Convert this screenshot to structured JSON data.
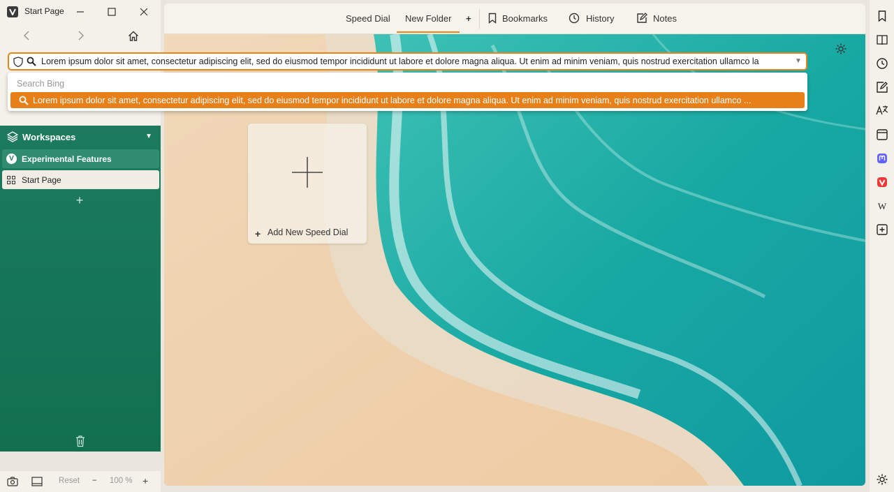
{
  "window": {
    "title": "Start Page",
    "minimize": "—",
    "maximize": "☐",
    "close": "✕"
  },
  "nav": {
    "back": "‹",
    "forward": "›",
    "home": "⌂"
  },
  "address_bar": {
    "value": "Lorem ipsum dolor sit amet, consectetur adipiscing elit, sed do eiusmod tempor incididunt ut labore et dolore magna aliqua. Ut enim ad minim veniam, quis nostrud exercitation ullamco la",
    "dropdown": "▼"
  },
  "suggestions": {
    "engine_label": "Search Bing",
    "hit": "Lorem ipsum dolor sit amet, consectetur adipiscing elit, sed do eiusmod tempor incididunt ut labore et dolore magna aliqua. Ut enim ad minim veniam, quis nostrud exercitation ullamco ..."
  },
  "panel": {
    "workspaces_label": "Workspaces",
    "items": [
      {
        "label": "Experimental Features",
        "icon": "vivaldi-icon"
      },
      {
        "label": "Start Page",
        "icon": "grid-icon"
      }
    ],
    "add_tab": "+"
  },
  "status_bar": {
    "reset": "Reset",
    "zoom_minus": "−",
    "zoom": "100 %",
    "zoom_plus": "+"
  },
  "start_page": {
    "tabs": [
      {
        "label": "Speed Dial",
        "active": false
      },
      {
        "label": "New Folder",
        "active": true
      }
    ],
    "add_folder": "+",
    "links": [
      {
        "label": "Bookmarks",
        "icon": "bookmark-icon"
      },
      {
        "label": "History",
        "icon": "clock-icon"
      },
      {
        "label": "Notes",
        "icon": "notes-icon"
      }
    ],
    "add_speed_dial_plus": "+",
    "add_speed_dial_label": "Add New Speed Dial"
  },
  "right_bar_icons": [
    "bookmark-icon",
    "reading-list-icon",
    "history-icon",
    "notes-icon",
    "translate-icon",
    "window-icon",
    "mastodon-icon",
    "vivaldi-icon",
    "wikipedia-icon",
    "add-panel-icon",
    "settings-icon"
  ],
  "colors": {
    "accent": "#e8841a",
    "panel_green": "#1d7a5d",
    "ocean": "#1fb3a8",
    "sand": "#f0d6b4"
  }
}
